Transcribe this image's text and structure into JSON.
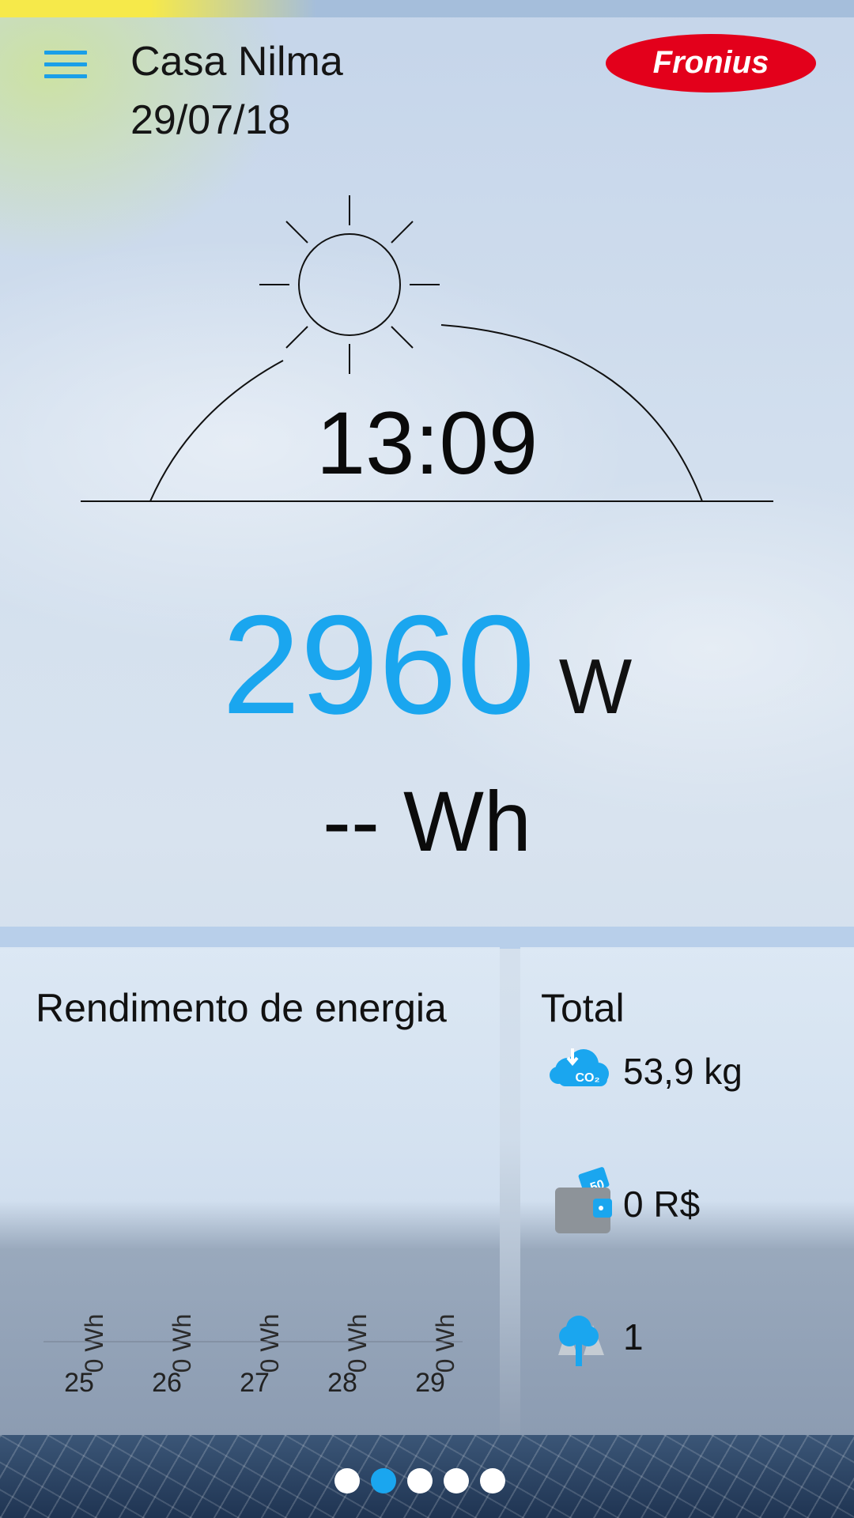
{
  "header": {
    "title": "Casa Nilma",
    "date": "29/07/18",
    "logo_text": "Fronius",
    "menu_icon": "hamburger-menu-icon"
  },
  "current": {
    "time": "13:09",
    "power_value": "2960",
    "power_unit": "W",
    "energy_text": "-- Wh"
  },
  "yield_panel": {
    "title": "Rendimento de energia",
    "days": [
      {
        "day": "25",
        "value": "0 Wh"
      },
      {
        "day": "26",
        "value": "0 Wh"
      },
      {
        "day": "27",
        "value": "0 Wh"
      },
      {
        "day": "28",
        "value": "0 Wh"
      },
      {
        "day": "29",
        "value": "0 Wh"
      }
    ]
  },
  "total_panel": {
    "title": "Total",
    "items": [
      {
        "icon": "co2-cloud-icon",
        "value": "53,9 kg"
      },
      {
        "icon": "wallet-money-icon",
        "value": "0 R$"
      },
      {
        "icon": "tree-icon",
        "value": "1"
      }
    ]
  },
  "pagination": {
    "count": 5,
    "active_index": 1
  },
  "colors": {
    "accent": "#1aa6ef",
    "logo_red": "#e3001b",
    "text": "#111111"
  }
}
